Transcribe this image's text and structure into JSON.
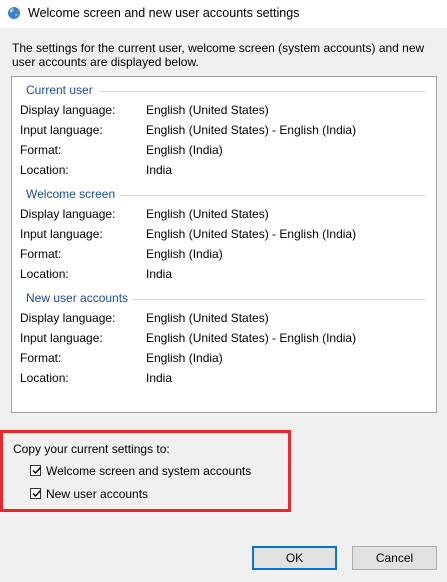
{
  "window": {
    "title": "Welcome screen and new user accounts settings"
  },
  "intro_text": "The settings for the current user, welcome screen (system accounts) and new user accounts are displayed below.",
  "sections": [
    {
      "heading": "Current user",
      "rows": [
        {
          "key": "Display language:",
          "value": "English (United States)"
        },
        {
          "key": "Input language:",
          "value": "English (United States) - English (India)"
        },
        {
          "key": "Format:",
          "value": "English (India)"
        },
        {
          "key": "Location:",
          "value": "India"
        }
      ]
    },
    {
      "heading": "Welcome screen",
      "rows": [
        {
          "key": "Display language:",
          "value": "English (United States)"
        },
        {
          "key": "Input language:",
          "value": "English (United States) - English (India)"
        },
        {
          "key": "Format:",
          "value": "English (India)"
        },
        {
          "key": "Location:",
          "value": "India"
        }
      ]
    },
    {
      "heading": "New user accounts",
      "rows": [
        {
          "key": "Display language:",
          "value": "English (United States)"
        },
        {
          "key": "Input language:",
          "value": "English (United States) - English (India)"
        },
        {
          "key": "Format:",
          "value": "English (India)"
        },
        {
          "key": "Location:",
          "value": "India"
        }
      ]
    }
  ],
  "copy": {
    "label": "Copy your current settings to:",
    "options": [
      {
        "label": "Welcome screen and system accounts",
        "checked": true
      },
      {
        "label": "New user accounts",
        "checked": true
      }
    ]
  },
  "buttons": {
    "ok": "OK",
    "cancel": "Cancel"
  },
  "colors": {
    "section_heading": "#1a4c9c",
    "highlight": "#e8262c",
    "default_button_border": "#0078d7"
  }
}
